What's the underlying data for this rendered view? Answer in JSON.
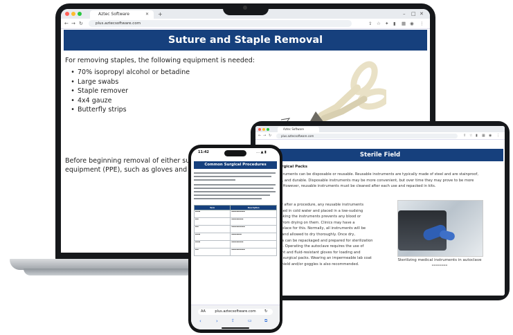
{
  "laptop": {
    "browser": {
      "tab_title": "Aztec Software",
      "url": "plus.aztecsoftware.com"
    },
    "page": {
      "title": "Suture and Staple Removal",
      "intro": "For removing staples, the following equipment is needed:",
      "equipment": [
        "70% isopropyl alcohol or betadine",
        "Large swabs",
        "Staple remover",
        "4x4 gauze",
        "Butterfly strips"
      ],
      "paragraph_line1": "Before beginning removal of either suture",
      "paragraph_line2": "equipment (PPE), such as gloves and a sur"
    }
  },
  "tablet": {
    "browser": {
      "tab_title": "Aztec Software",
      "url": "plus.aztecsoftware.com"
    },
    "page": {
      "title": "Sterile Field",
      "subheading": "Surgical Packs",
      "paragraph1": [
        "Instruments can be disposable or reusable. Reusable instruments are typically made of steel and are stainproof,",
        "ant, and durable. Disposable instruments may be more convenient, but over time they may prove to be more",
        "ve. However, reusable instruments must be cleaned after each use and repacked in kits."
      ],
      "paragraph2": [
        "tely after a procedure, any reusable instruments",
        "rinsed in cold water and placed in a low-sudsing",
        "Soaking the instruments prevents any blood or",
        "ds from drying on them. Clinics may have a",
        "ed place for this. Normally, all instruments will be",
        "ed and allowed to dry thoroughly. Once dry,",
        "ents can be repackaged and prepared for sterilization",
        "ave. Operating the autoclave requires the use of",
        "stant and fluid-resistant gloves for loading and",
        "ing surgical packs. Wearing an impermeable lab coat",
        "a shield and/or goggles is also recommended."
      ],
      "photo_caption": "Sterilizing medical instruments in autoclave"
    }
  },
  "phone": {
    "status": {
      "time": "11:42",
      "signal": "… ▲ ▮"
    },
    "page": {
      "title": "Common Surgical Procedures",
      "table_headers": [
        "Term",
        "Description"
      ],
      "row_count": 6
    },
    "browser": {
      "text_size": "AA",
      "url": "plus.aztecsoftware.com"
    }
  }
}
